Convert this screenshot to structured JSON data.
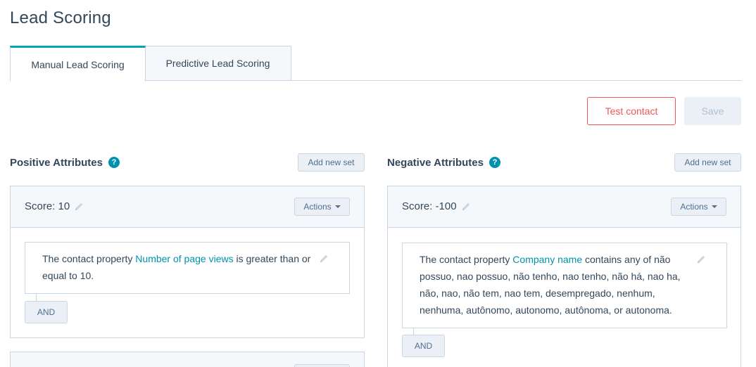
{
  "page": {
    "title": "Lead Scoring"
  },
  "tabs": [
    {
      "label": "Manual Lead Scoring",
      "active": true
    },
    {
      "label": "Predictive Lead Scoring",
      "active": false
    }
  ],
  "toolbar": {
    "test_contact_label": "Test contact",
    "save_label": "Save"
  },
  "positive": {
    "title": "Positive Attributes",
    "help_icon": "?",
    "add_set_label": "Add new set",
    "sets": [
      {
        "score_label": "Score: 10",
        "actions_label": "Actions",
        "criteria": {
          "prefix": "The contact property ",
          "property": "Number of page views",
          "suffix": " is greater than or equal to 10."
        },
        "and_label": "AND"
      }
    ]
  },
  "negative": {
    "title": "Negative Attributes",
    "help_icon": "?",
    "add_set_label": "Add new set",
    "sets": [
      {
        "score_label": "Score: -100",
        "actions_label": "Actions",
        "criteria": {
          "prefix": "The contact property ",
          "property": "Company name",
          "suffix": " contains any of não possuo, nao possuo, não tenho, nao tenho, não há, nao ha, não, nao, não tem, nao tem, desempregado, nenhum, nenhuma, autônomo, autonomo, autônoma, or autonoma."
        },
        "and_label": "AND"
      }
    ]
  },
  "colors": {
    "accent": "#00a4bd",
    "link": "#0091ae",
    "danger": "#f2545b",
    "text": "#33475b",
    "border": "#cbd6e2",
    "panel_bg": "#f5f8fa"
  },
  "icons": {
    "help": "question-circle-icon",
    "edit": "pencil-icon",
    "dropdown": "caret-down-icon"
  }
}
